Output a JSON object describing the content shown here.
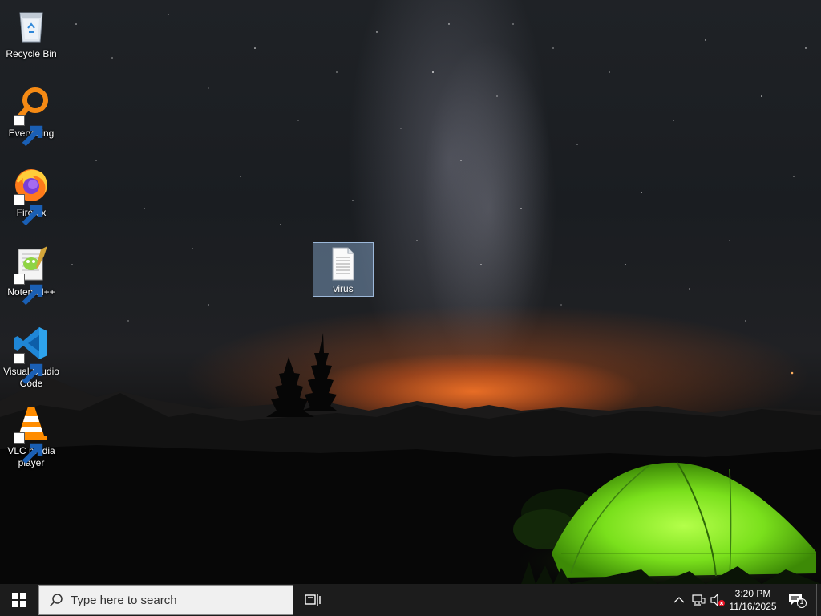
{
  "desktop": {
    "icons": [
      {
        "label": "Recycle Bin",
        "icon": "recycle-bin-icon"
      },
      {
        "label": "Everything",
        "icon": "everything-search-icon"
      },
      {
        "label": "Firefox",
        "icon": "firefox-icon"
      },
      {
        "label": "Notepad++",
        "icon": "notepad-plus-plus-icon"
      },
      {
        "label": "Visual Studio Code",
        "icon": "vscode-icon"
      },
      {
        "label": "VLC media player",
        "icon": "vlc-icon"
      }
    ],
    "selected_file": {
      "label": "virus",
      "icon": "text-file-icon"
    }
  },
  "taskbar": {
    "search_placeholder": "Type here to search",
    "clock_time": "3:20 PM",
    "clock_date": "11/16/2025",
    "notification_count": "1",
    "accent_color": "#0078d7",
    "background_color": "#1c1c1c"
  }
}
